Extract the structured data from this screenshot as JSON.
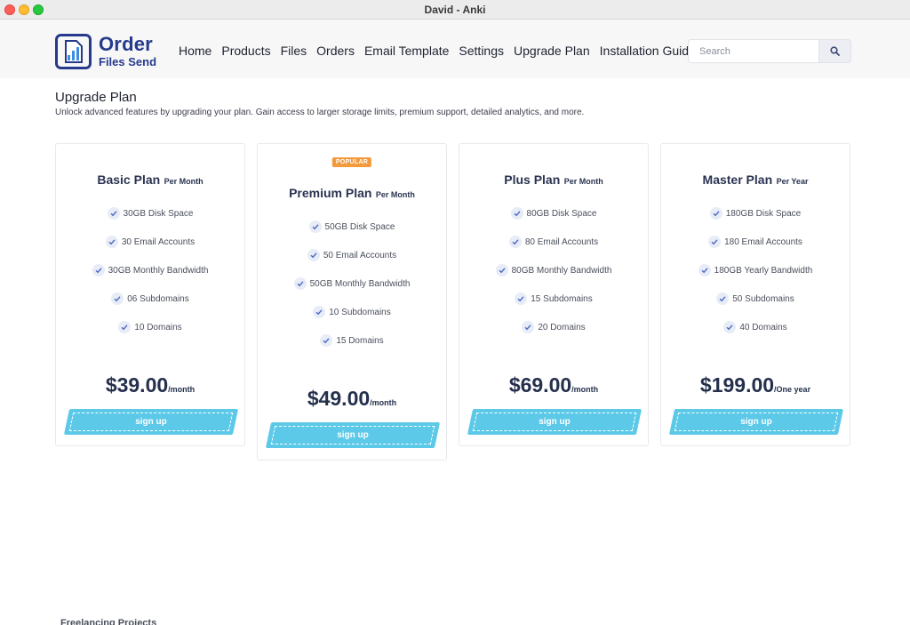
{
  "window": {
    "title": "David - Anki"
  },
  "header": {
    "logo_line1": "Order",
    "logo_line2": "Files Send",
    "nav": [
      "Home",
      "Products",
      "Files",
      "Orders",
      "Email Template",
      "Settings",
      "Upgrade Plan",
      "Installation Guide"
    ],
    "search_placeholder": "Search"
  },
  "page": {
    "title": "Upgrade Plan",
    "subtitle": "Unlock advanced features by upgrading your plan. Gain access to larger storage limits, premium support, detailed analytics, and more."
  },
  "plans": [
    {
      "name": "Basic Plan",
      "period": "Per Month",
      "features": [
        "30GB Disk Space",
        "30 Email Accounts",
        "30GB Monthly Bandwidth",
        "06 Subdomains",
        "10 Domains"
      ],
      "price": "$39.00",
      "unit": "/month",
      "button": "sign up"
    },
    {
      "badge": "POPULAR",
      "name": "Premium Plan",
      "period": "Per Month",
      "features": [
        "50GB Disk Space",
        "50 Email Accounts",
        "50GB Monthly Bandwidth",
        "10 Subdomains",
        "15 Domains"
      ],
      "price": "$49.00",
      "unit": "/month",
      "button": "sign up"
    },
    {
      "name": "Plus Plan",
      "period": "Per Month",
      "features": [
        "80GB Disk Space",
        "80 Email Accounts",
        "80GB Monthly Bandwidth",
        "15 Subdomains",
        "20 Domains"
      ],
      "price": "$69.00",
      "unit": "/month",
      "button": "sign up"
    },
    {
      "name": "Master Plan",
      "period": "Per Year",
      "features": [
        "180GB Disk Space",
        "180 Email Accounts",
        "180GB Yearly Bandwidth",
        "50 Subdomains",
        "40 Domains"
      ],
      "price": "$199.00",
      "unit": "/One year",
      "button": "sign up"
    }
  ],
  "footer": {
    "section_title": "Freelancing Projects"
  },
  "colors": {
    "brand": "#263a8c",
    "button": "#5cc9e8",
    "badge": "#f39a3d"
  }
}
